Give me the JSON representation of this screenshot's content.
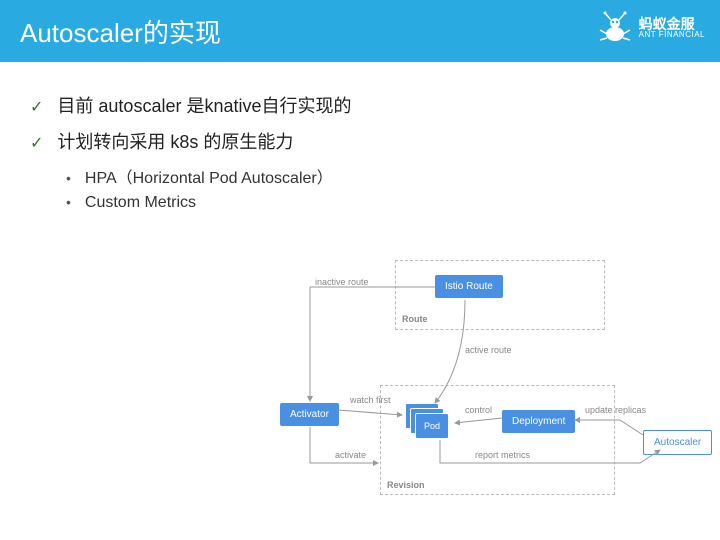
{
  "header": {
    "title": "Autoscaler的实现"
  },
  "logo": {
    "cn": "蚂蚁金服",
    "en": "ANT FINANCIAL"
  },
  "bullets": {
    "b1": "目前 autoscaler 是knative自行实现的",
    "b2": "计划转向采用 k8s 的原生能力",
    "s1": "HPA（Horizontal Pod Autoscaler）",
    "s2": "Custom Metrics"
  },
  "diagram": {
    "groups": {
      "route": "Route",
      "revision": "Revision"
    },
    "nodes": {
      "istio": "Istio Route",
      "activator": "Activator",
      "pod": "Pod",
      "deployment": "Deployment",
      "autoscaler": "Autoscaler"
    },
    "edges": {
      "inactive": "inactive route",
      "active": "active route",
      "watch": "watch first",
      "activate": "activate",
      "control": "control",
      "report": "report metrics",
      "update": "update replicas"
    }
  }
}
